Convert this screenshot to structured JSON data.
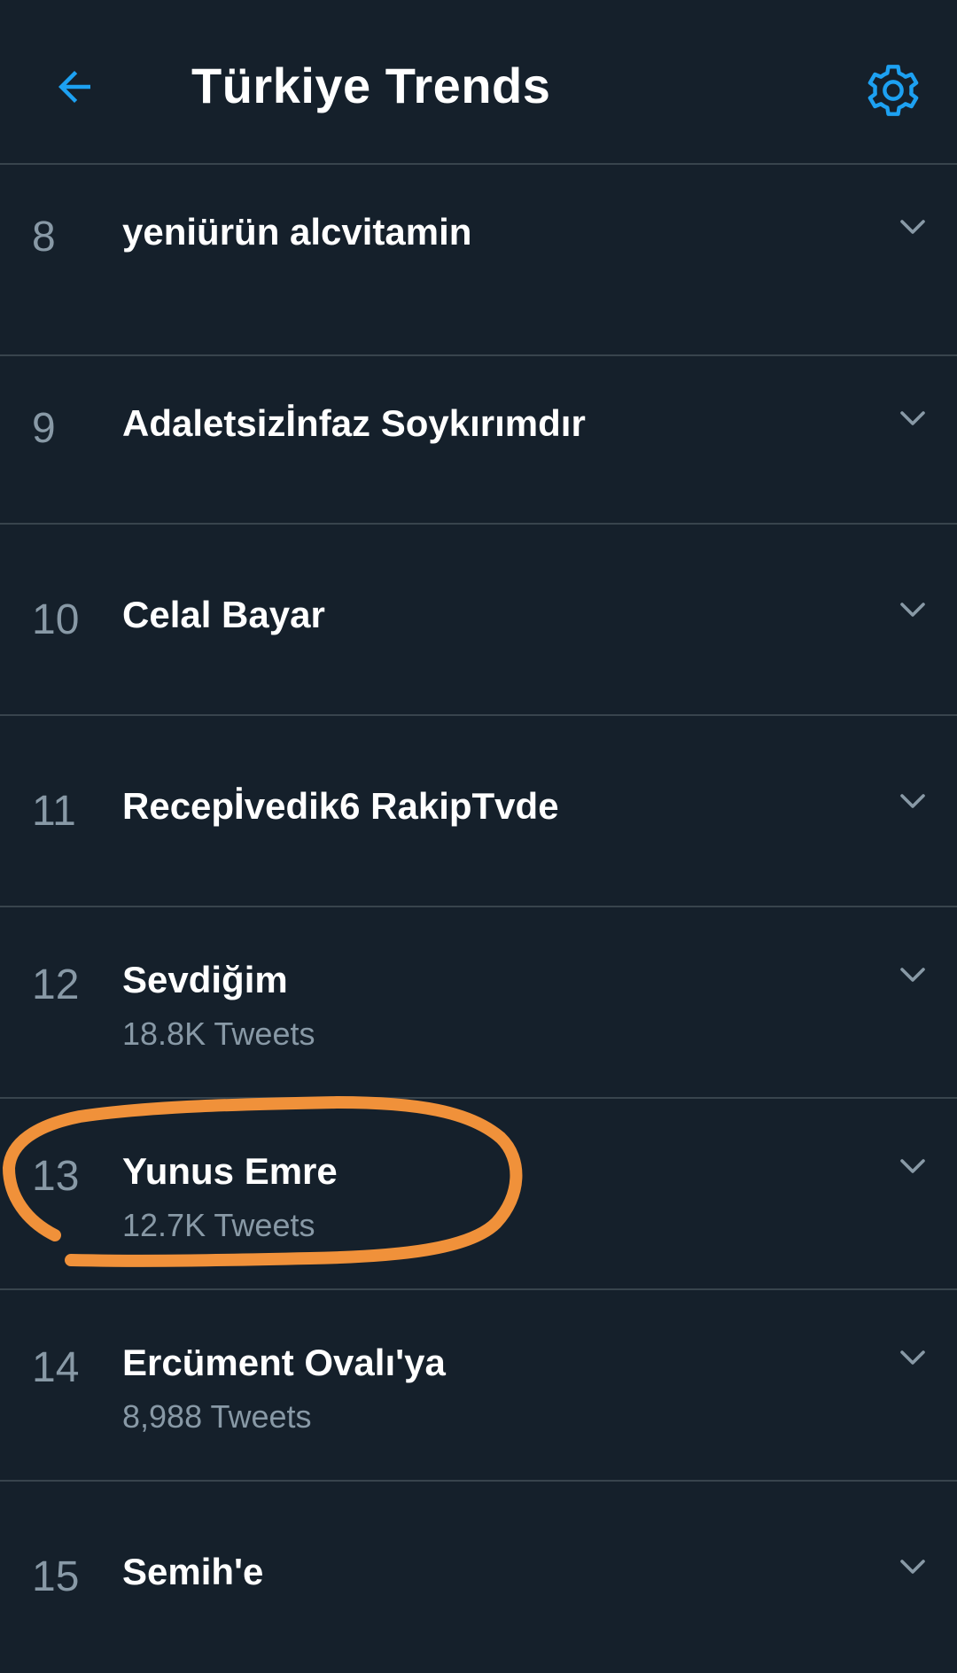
{
  "header": {
    "title": "Türkiye Trends",
    "back_icon": "arrow-left-icon",
    "settings_icon": "gear-icon",
    "accent_color": "#1da1f2"
  },
  "trends": [
    {
      "rank": "8",
      "name": "yeniürün alcvitamin",
      "tweets": ""
    },
    {
      "rank": "9",
      "name": "Adaletsizİnfaz Soykırımdır",
      "tweets": ""
    },
    {
      "rank": "10",
      "name": "Celal Bayar",
      "tweets": ""
    },
    {
      "rank": "11",
      "name": "Recepİvedik6 RakipTvde",
      "tweets": ""
    },
    {
      "rank": "12",
      "name": "Sevdiğim",
      "tweets": "18.8K Tweets"
    },
    {
      "rank": "13",
      "name": "Yunus Emre",
      "tweets": "12.7K Tweets"
    },
    {
      "rank": "14",
      "name": "Ercüment Ovalı'ya",
      "tweets": "8,988 Tweets"
    },
    {
      "rank": "15",
      "name": "Semih'e",
      "tweets": ""
    }
  ],
  "chevron_icon": "chevron-down-icon",
  "annotation_color": "#f0913a",
  "colors": {
    "background": "#15202b",
    "divider": "#38444d",
    "secondary_text": "#8899a6"
  }
}
